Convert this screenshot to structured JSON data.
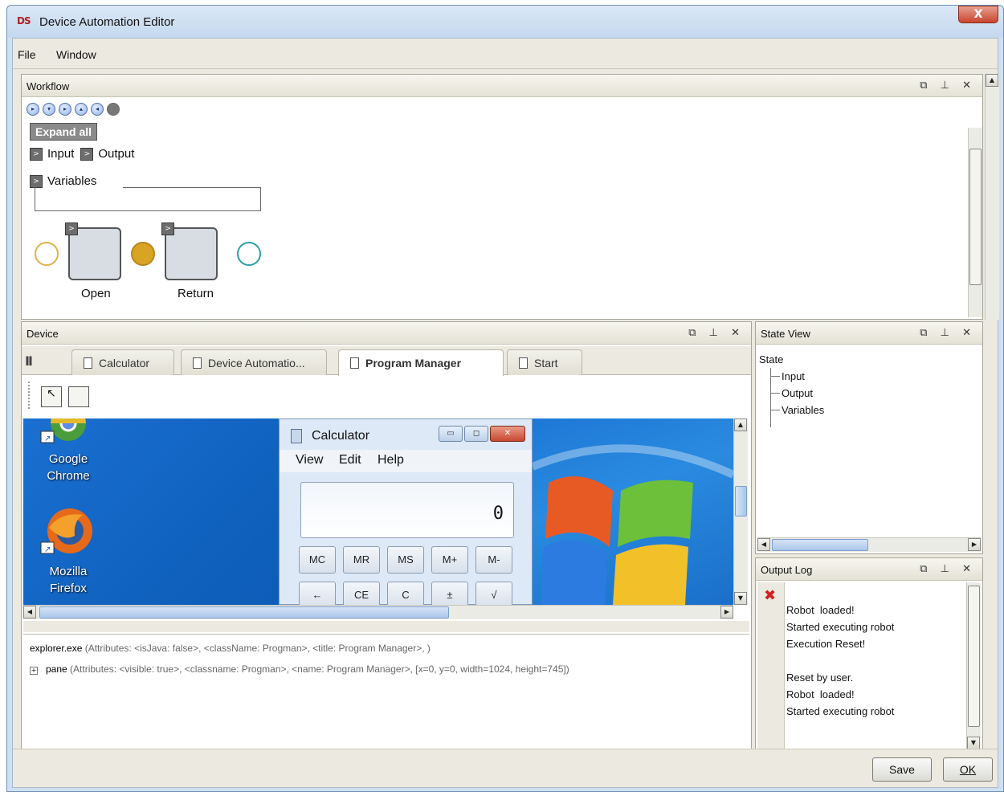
{
  "window": {
    "logo": "DS",
    "title": "Device Automation Editor",
    "close_glyph": "X"
  },
  "menu": [
    "File",
    "Window"
  ],
  "workflow": {
    "title": "Workflow",
    "controls": "⧉ ⊥ ✕",
    "toolbar_icons": [
      "play-icon",
      "step-icon",
      "step-over-icon",
      "step-out-icon",
      "rewind-icon",
      "stop-icon"
    ],
    "expand_all": "Expand all",
    "input_label": "Input",
    "output_label": "Output",
    "variables_label": "Variables",
    "node_open": "Open",
    "node_return": "Return",
    "node_btn_glyph": ">",
    "colors": {
      "start_circle": "#e4b04a",
      "mid_circle": "#d9a326",
      "end_circle": "#2aa0a8"
    }
  },
  "device": {
    "title": "Device",
    "controls": "⧉ ⊥ ✕",
    "pause_glyph": "II",
    "tabs": [
      "Calculator",
      "Device Automatio...",
      "Program Manager",
      "Start"
    ],
    "active_tab": "Program Manager",
    "desktop": {
      "icon1_label": "Google\nChrome",
      "icon2_label": "Mozilla\nFirefox"
    },
    "calculator": {
      "title": "Calculator",
      "menu": [
        "View",
        "Edit",
        "Help"
      ],
      "display": "0",
      "keys_row1": [
        "MC",
        "MR",
        "MS",
        "M+",
        "M-"
      ],
      "keys_row2": [
        "←",
        "CE",
        "C",
        "±",
        "√"
      ]
    },
    "properties": {
      "line1_name": "explorer.exe",
      "line1_attrs": " (Attributes: <isJava: false>, <className: Progman>, <title: Program Manager>, )",
      "line2_name": "pane",
      "line2_attrs": " (Attributes: <visible: true>, <classname: Progman>, <name: Program Manager>, [x=0, y=0, width=1024, height=745])"
    }
  },
  "state_view": {
    "title": "State View",
    "controls": "⧉ ⊥ ✕",
    "root": "State",
    "children": [
      "Input",
      "Output",
      "Variables"
    ]
  },
  "output_log": {
    "title": "Output Log",
    "controls": "⧉ ⊥ ✕",
    "clear_glyph": "✖",
    "lines": "Robot  loaded!\nStarted executing robot\nExecution Reset!\n\nReset by user.\nRobot  loaded!\nStarted executing robot"
  },
  "footer": {
    "save": "Save",
    "ok": "OK"
  }
}
